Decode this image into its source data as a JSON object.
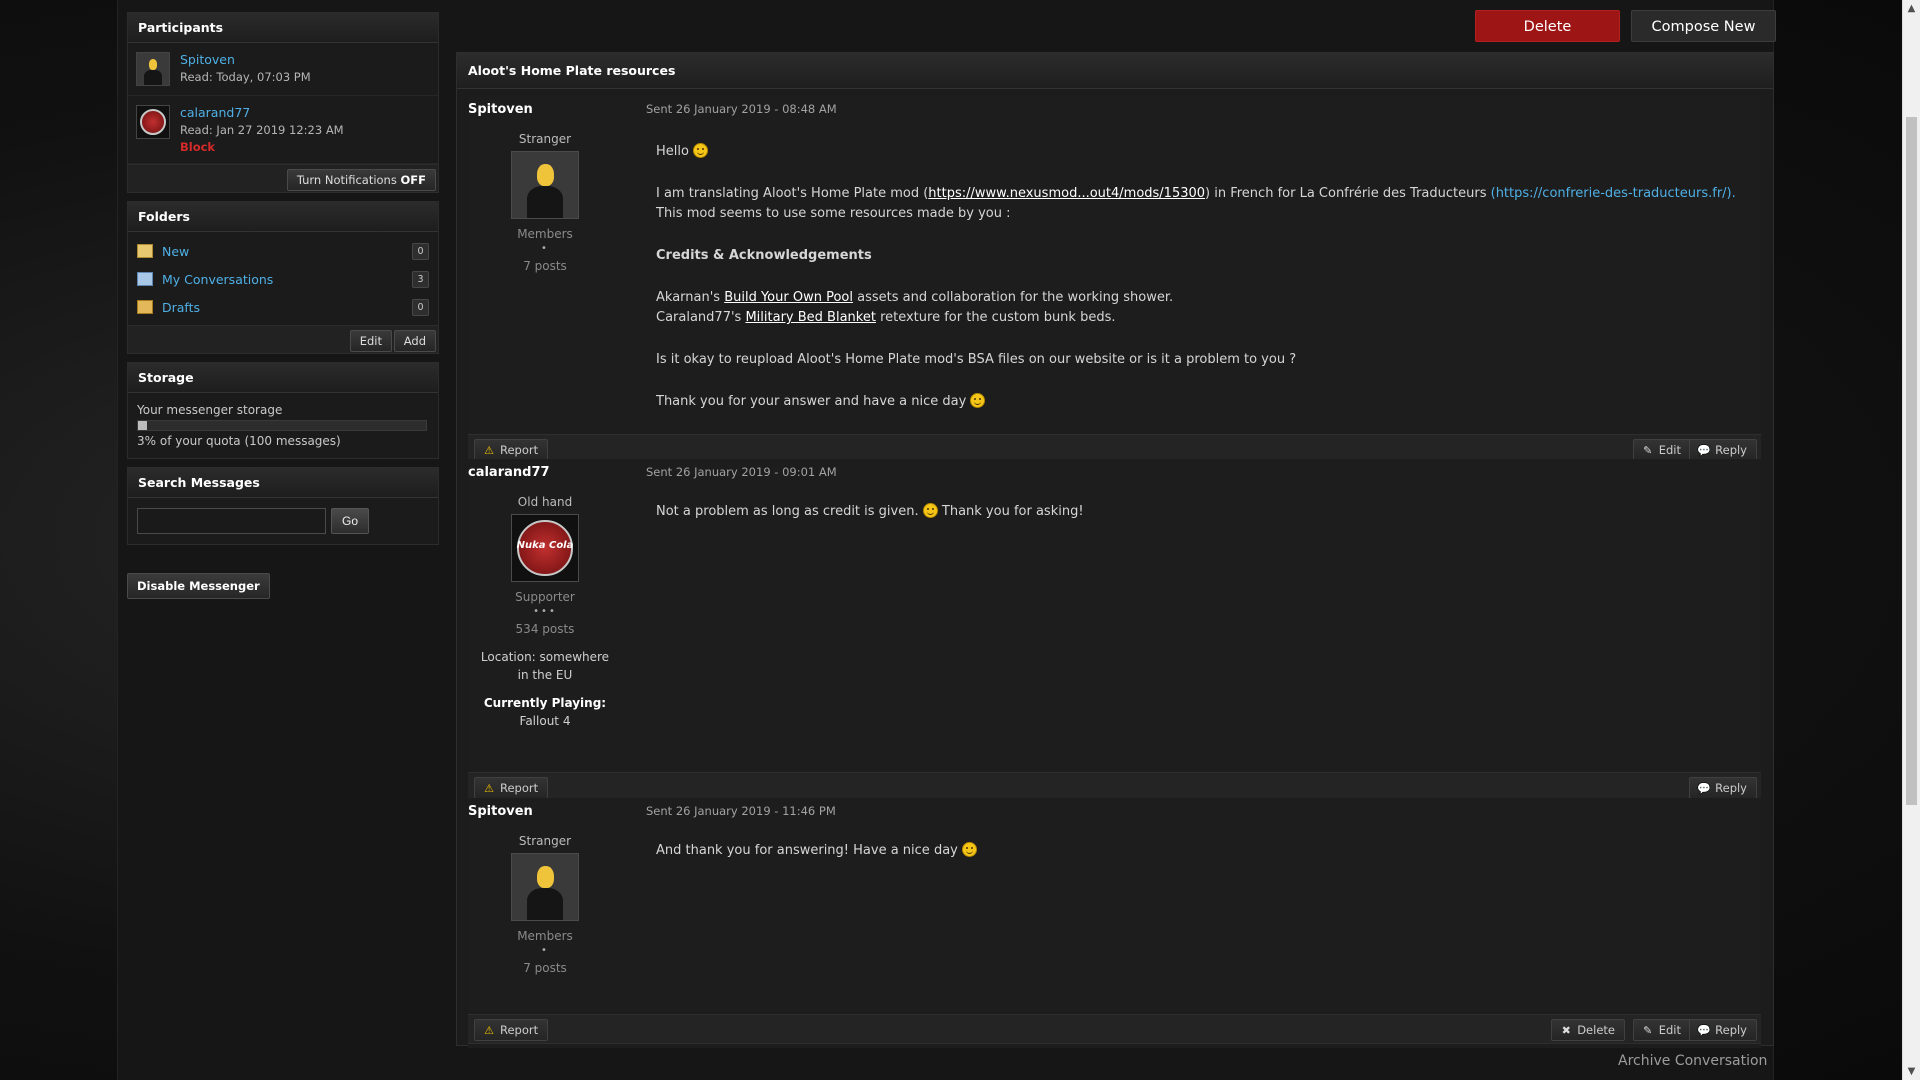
{
  "top_actions": {
    "delete_label": "Delete",
    "compose_label": "Compose New"
  },
  "sidebar": {
    "participants": {
      "title": "Participants",
      "items": [
        {
          "name": "Spitoven",
          "read": "Read: Today, 07:03 PM",
          "block": ""
        },
        {
          "name": "calarand77",
          "read": "Read: Jan 27 2019 12:23 AM",
          "block": "Block"
        }
      ],
      "notif_label": "Turn Notifications",
      "notif_state": "OFF"
    },
    "folders": {
      "title": "Folders",
      "items": [
        {
          "label": "New",
          "count": "0"
        },
        {
          "label": "My Conversations",
          "count": "3"
        },
        {
          "label": "Drafts",
          "count": "0"
        }
      ],
      "edit_label": "Edit",
      "add_label": "Add"
    },
    "storage": {
      "title": "Storage",
      "label": "Your messenger storage",
      "percent": 3,
      "quota_text": "3% of your quota (100 messages)"
    },
    "search": {
      "title": "Search Messages",
      "value": "",
      "go_label": "Go"
    },
    "disable_label": "Disable Messenger"
  },
  "conversation": {
    "title": "Aloot's Home Plate resources",
    "posts": [
      {
        "author": "Spitoven",
        "date": "Sent 26 January 2019 - 08:48 AM",
        "rank": "Stranger",
        "group": "Members",
        "pips": "•",
        "posts": "7 posts",
        "body": {
          "p1": "Hello",
          "p2a": "I am translating Aloot's Home Plate mod (",
          "p2link": "https://www.nexusmod...out4/mods/15300",
          "p2b": ") in French for La Confrérie des Traducteurs ",
          "p2link2": "(https://confrerie-des-traducteurs.fr/).",
          "p2c": "This mod seems to use some resources made by you :",
          "p3": "Credits & Acknowledgements",
          "p4a": "Akarnan's ",
          "p4link": "Build Your Own Pool",
          "p4b": " assets and collaboration for the working shower.",
          "p5a": "Caraland77's ",
          "p5link": "Military Bed Blanket",
          "p5b": " retexture for the custom bunk beds.",
          "p6": "Is it okay to reupload Aloot's Home Plate mod's BSA files on our website or is it a problem to you ?",
          "p7": "Thank you for your answer and have a nice day"
        },
        "actions": {
          "report": "Report",
          "edit": "Edit",
          "reply": "Reply"
        }
      },
      {
        "author": "calarand77",
        "date": "Sent 26 January 2019 - 09:01 AM",
        "rank": "Old hand",
        "group": "Supporter",
        "pips": "•••",
        "posts": "534 posts",
        "location": "Location: somewhere in the EU",
        "playing_label": "Currently Playing:",
        "playing": "Fallout 4",
        "avatar_text": "Nuka Cola",
        "body": {
          "p1a": "Not a problem as long as credit is given.",
          "p1b": "Thank you for asking!"
        },
        "actions": {
          "report": "Report",
          "reply": "Reply"
        }
      },
      {
        "author": "Spitoven",
        "date": "Sent 26 January 2019 - 11:46 PM",
        "rank": "Stranger",
        "group": "Members",
        "pips": "•",
        "posts": "7 posts",
        "body": {
          "p1": "And thank you for answering! Have a nice day"
        },
        "actions": {
          "report": "Report",
          "delete": "Delete",
          "edit": "Edit",
          "reply": "Reply"
        }
      }
    ],
    "archive_label": "Archive Conversation"
  },
  "colors": {
    "accent": "#4fb0e6",
    "danger": "#9e1515",
    "block": "#d42a2a"
  }
}
